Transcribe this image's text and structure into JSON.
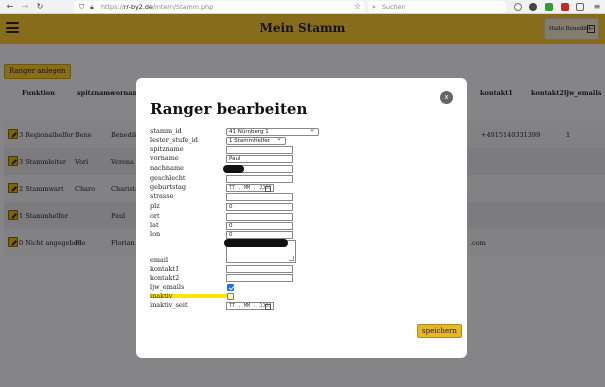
{
  "browser": {
    "url_prefix": "https://",
    "url_host": "rr-by2.de",
    "url_path": "/intern/Stamm.php",
    "search_placeholder": "Suchen"
  },
  "header": {
    "title": "Mein Stamm",
    "user_label": "Hallo Benedikt"
  },
  "page": {
    "add_button": "Ranger anlegen",
    "columns": [
      "Funktion",
      "spitzname",
      "vorname",
      "kontakt1",
      "kontakt2",
      "ljw_emails"
    ],
    "rows": [
      {
        "funktion": "3 Regionalhelfer",
        "spitzname": "Bene",
        "vorname": "Benedikt",
        "kontakt1": "+4915140331399",
        "kontakt2": "",
        "ljw": "1"
      },
      {
        "funktion": "3 Stammleiter",
        "spitzname": "Vori",
        "vorname": "Verena",
        "kontakt1": "",
        "kontakt2": "",
        "ljw": ""
      },
      {
        "funktion": "2 Stammwart",
        "spitzname": "Charo",
        "vorname": "Charista",
        "kontakt1": "",
        "kontakt2": "",
        "ljw": ""
      },
      {
        "funktion": "1 Stammhelfer",
        "spitzname": "",
        "vorname": "Paul",
        "kontakt1": "",
        "kontakt2": "",
        "ljw": ""
      },
      {
        "funktion": "0 Nicht angegeben",
        "spitzname": "Flo",
        "vorname": "Florian",
        "kontakt1": ".com",
        "kontakt2": "",
        "ljw": ""
      }
    ]
  },
  "modal": {
    "title": "Ranger bearbeiten",
    "close_label": "x",
    "labels": {
      "stamm_id": "stamm_id",
      "lester_stufe_id": "lester_stufe_id",
      "spitzname": "spitzname",
      "vorname": "vorname",
      "nachname": "nachname",
      "geschlecht": "geschlecht",
      "geburtstag": "geburtstag",
      "strasse": "strasse",
      "plz": "plz",
      "ort": "ort",
      "lat": "lat",
      "lon": "lon",
      "email": "email",
      "kontakt1": "kontakt1",
      "kontakt2": "kontakt2",
      "ljw_emails": "ljw_emails",
      "inaktiv": "inaktiv",
      "inaktiv_seit": "inaktiv_seit"
    },
    "values": {
      "stamm_id": "41 Nürnberg 1",
      "lester_stufe_id": "1 Stammhelfer",
      "vorname": "Paul",
      "plz": "0",
      "lat": "0",
      "lon": "0",
      "date_placeholder": "TT . MM . JJJJ"
    },
    "ljw_emails_checked": true,
    "inaktiv_checked": false,
    "save_label": "speichern"
  }
}
